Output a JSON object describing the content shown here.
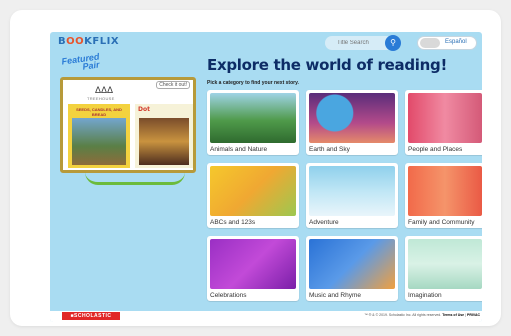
{
  "app": {
    "logo_pre": "B",
    "logo_oo": "OO",
    "logo_post": "KFLIX"
  },
  "search": {
    "placeholder": "Title Search",
    "icon": "magnifier-icon"
  },
  "language_toggle": {
    "label": "Español",
    "state": "off"
  },
  "featured": {
    "title_line1": "Featured",
    "title_line2": "Pair",
    "check_label": "Check it out!",
    "brand_mark": "ΔΔΔ",
    "brand_name": "TREEHOUSE",
    "book1_title": "SEEDS, CANDLES, AND BREAD",
    "book2_title": "Dot"
  },
  "main": {
    "heading": "Explore the world of reading!",
    "subheading": "Pick a category to find your next story."
  },
  "categories": [
    {
      "label": "Animals and Nature"
    },
    {
      "label": "Earth and Sky"
    },
    {
      "label": "People and Places"
    },
    {
      "label": "ABCs and 123s"
    },
    {
      "label": "Adventure"
    },
    {
      "label": "Family and Community"
    },
    {
      "label": "Celebrations"
    },
    {
      "label": "Music and Rhyme"
    },
    {
      "label": "Imagination"
    }
  ],
  "footer": {
    "brand": "■SCHOLASTIC",
    "copyright": "™ ® & © 2019. Scholastic Inc. All rights reserved.",
    "terms": "Terms of Use",
    "separator": "|",
    "privacy": "PRIVAC"
  },
  "colors": {
    "accent": "#2a7bd6",
    "heading": "#0d2c66",
    "background": "#a9dcf2",
    "scholastic_red": "#e12826"
  }
}
